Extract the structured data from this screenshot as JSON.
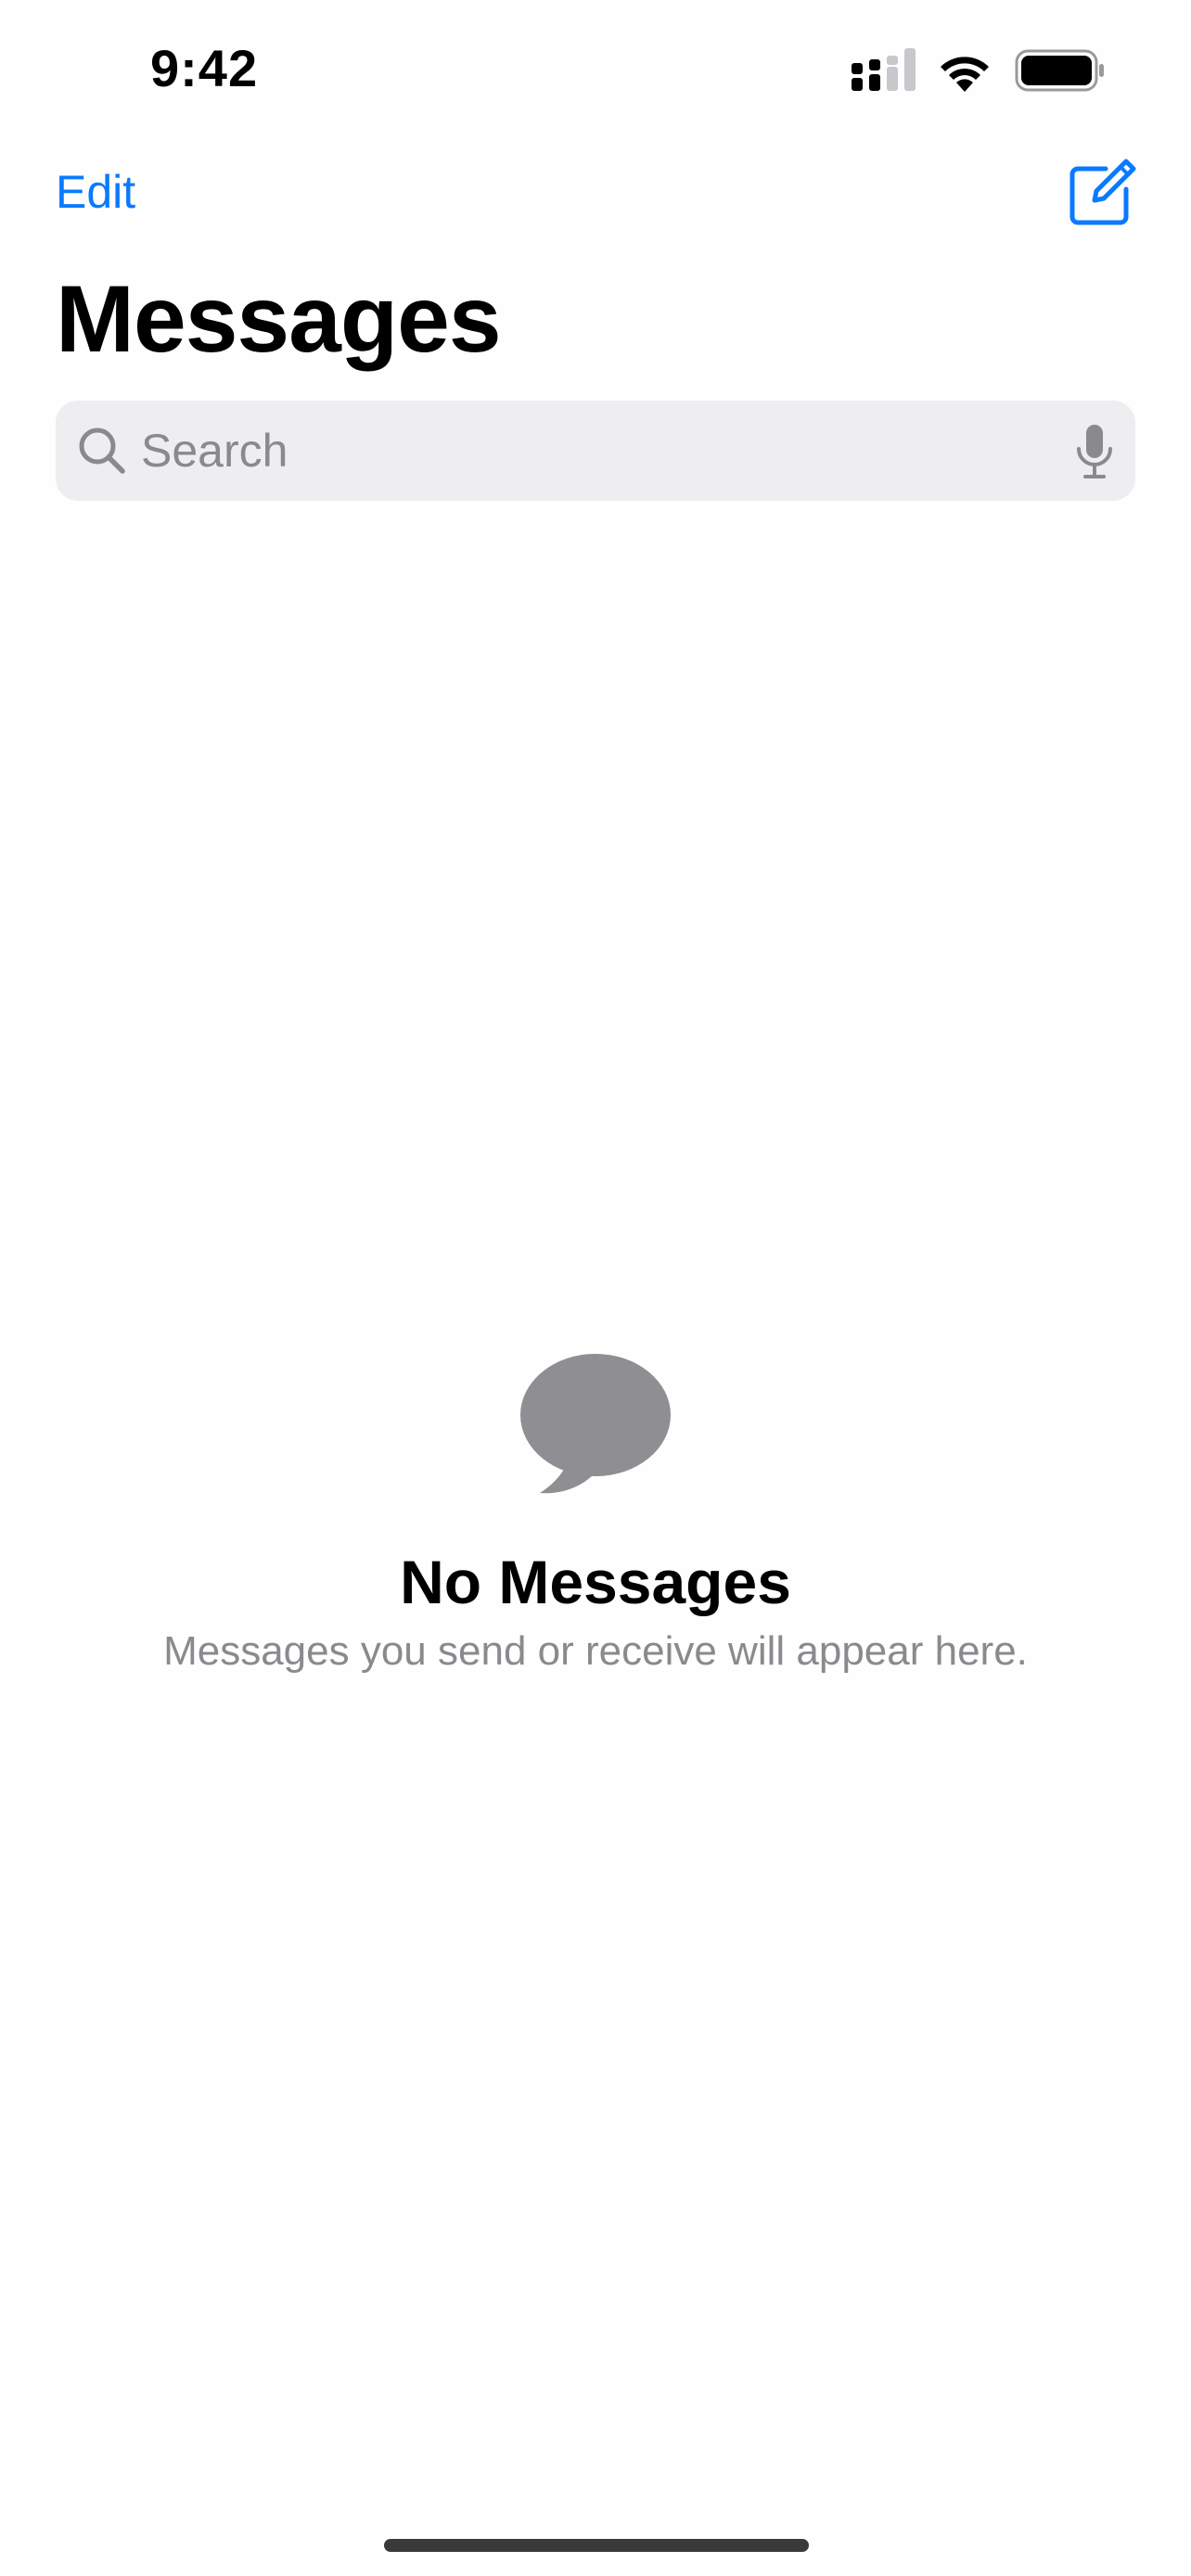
{
  "status_bar": {
    "time": "9:42",
    "icons": [
      "cellular-signal-icon",
      "wifi-icon",
      "battery-icon"
    ]
  },
  "nav": {
    "edit_label": "Edit",
    "compose_icon": "compose-icon"
  },
  "header": {
    "title": "Messages"
  },
  "search": {
    "placeholder": "Search",
    "left_icon": "search-icon",
    "right_icon": "microphone-icon"
  },
  "empty_state": {
    "icon": "message-bubble-icon",
    "title": "No Messages",
    "subtitle": "Messages you send or receive will appear here."
  },
  "colors": {
    "accent": "#0a7aff",
    "secondary_text": "#8a8a8e",
    "search_background": "#eeeef0",
    "bubble": "#8e8e93"
  }
}
